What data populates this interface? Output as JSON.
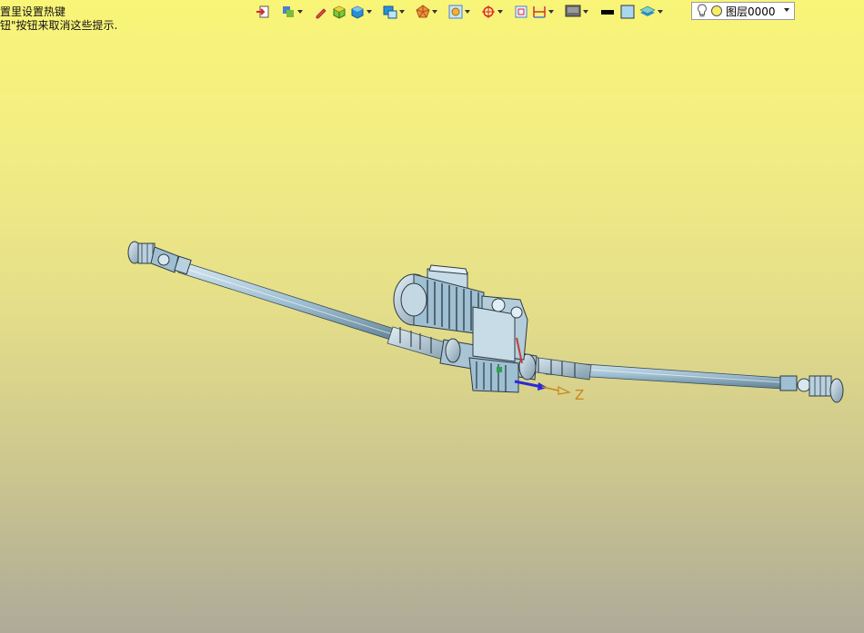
{
  "hint": {
    "line1": "置里设置热键",
    "line2": "钮\"按钮来取消这些提示."
  },
  "toolbar": {
    "icons": [
      "import-icon",
      "render-mode-icon",
      "pencil-icon",
      "shaded-box-icon",
      "solid-box-icon",
      "view-box-icon",
      "orientation-icon",
      "display-icon",
      "target-icon",
      "frame-icon",
      "dimension-icon",
      "monitor-icon",
      "color-swatch-icon",
      "fill-color-icon",
      "layer-stack-icon"
    ],
    "colors": {
      "line_color": "#000000",
      "fill_color": "#a8d8f0"
    }
  },
  "layer": {
    "label": "图层0000"
  },
  "triad": {
    "axis_label": "Z"
  }
}
